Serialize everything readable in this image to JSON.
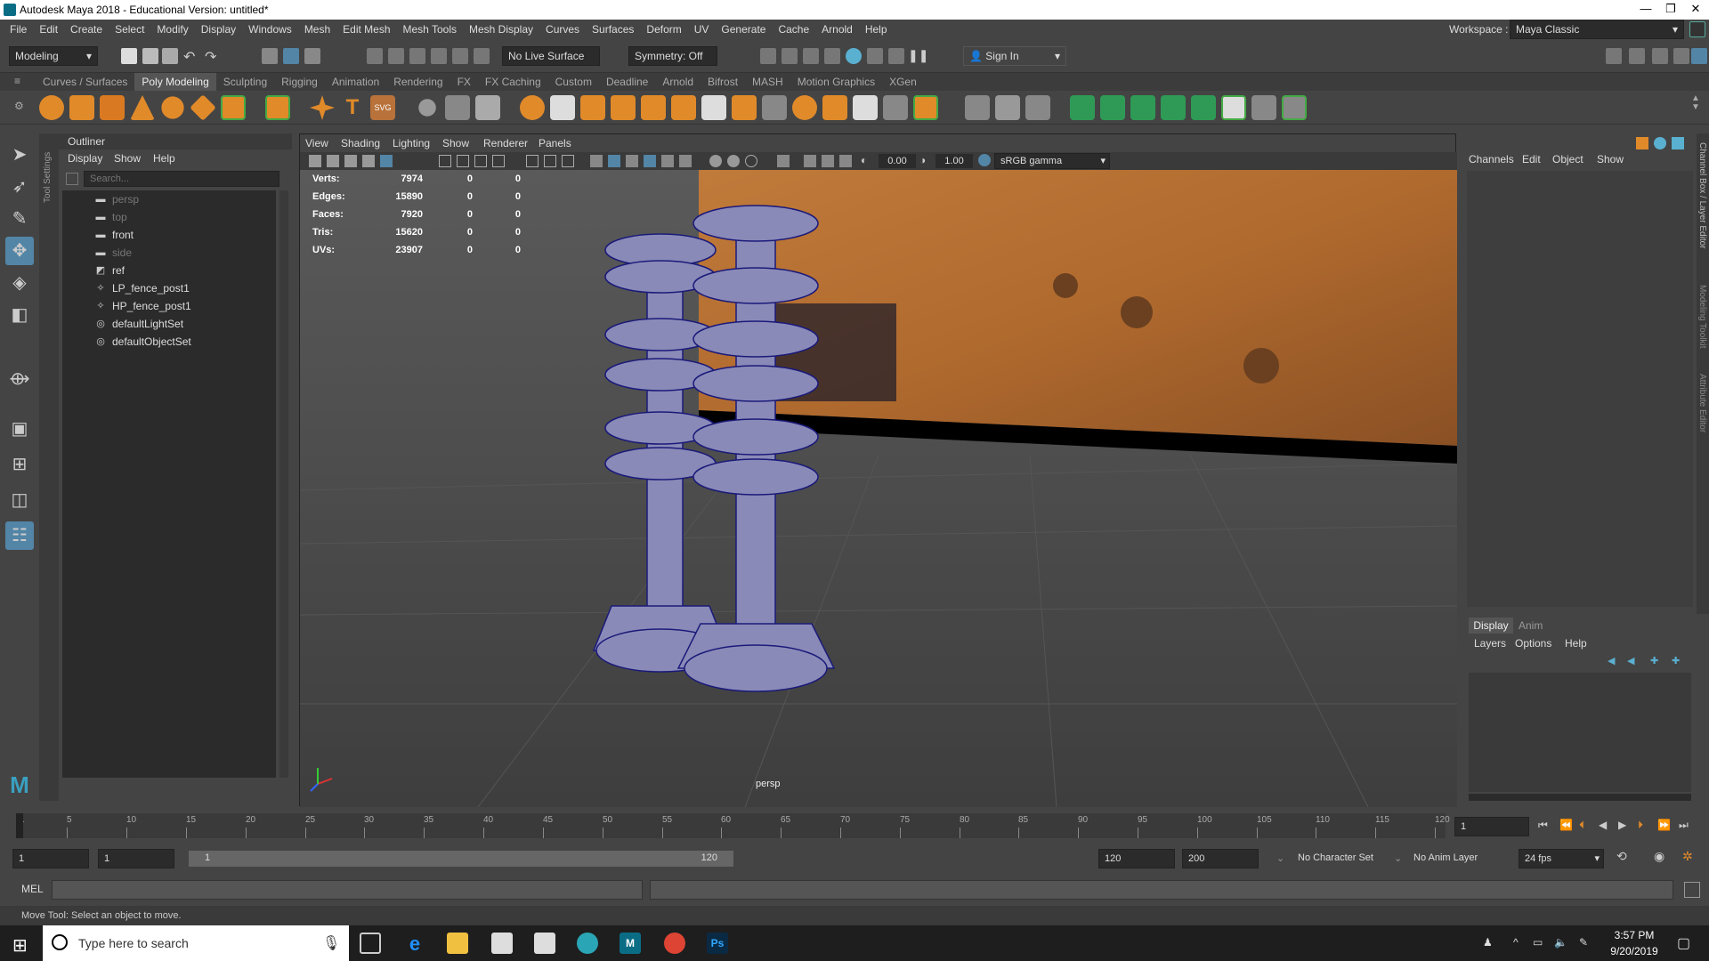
{
  "window": {
    "title": "Autodesk Maya 2018 - Educational Version: untitled*"
  },
  "menus": [
    "File",
    "Edit",
    "Create",
    "Select",
    "Modify",
    "Display",
    "Windows",
    "Mesh",
    "Edit Mesh",
    "Mesh Tools",
    "Mesh Display",
    "Curves",
    "Surfaces",
    "Deform",
    "UV",
    "Generate",
    "Cache",
    "Arnold",
    "Help"
  ],
  "workspace": {
    "label": "Workspace :",
    "value": "Maya Classic"
  },
  "statusline": {
    "menuset": "Modeling",
    "live_surface": "No Live Surface",
    "symmetry": "Symmetry: Off",
    "sign_in": "Sign In"
  },
  "shelf_tabs": [
    "Curves / Surfaces",
    "Poly Modeling",
    "Sculpting",
    "Rigging",
    "Animation",
    "Rendering",
    "FX",
    "FX Caching",
    "Custom",
    "Deadline",
    "Arnold",
    "Bifrost",
    "MASH",
    "Motion Graphics",
    "XGen"
  ],
  "shelf_active": "Poly Modeling",
  "outliner": {
    "title": "Outliner",
    "menus": [
      "Display",
      "Show",
      "Help"
    ],
    "search_placeholder": "Search...",
    "items": [
      {
        "label": "persp",
        "icon": "camera-icon",
        "dim": true
      },
      {
        "label": "top",
        "icon": "camera-icon",
        "dim": true
      },
      {
        "label": "front",
        "icon": "camera-icon",
        "dim": false
      },
      {
        "label": "side",
        "icon": "camera-icon",
        "dim": true
      },
      {
        "label": "ref",
        "icon": "image-plane-icon",
        "dim": false
      },
      {
        "label": "LP_fence_post1",
        "icon": "transform-icon",
        "dim": false
      },
      {
        "label": "HP_fence_post1",
        "icon": "transform-icon",
        "dim": false
      },
      {
        "label": "defaultLightSet",
        "icon": "set-icon",
        "dim": false
      },
      {
        "label": "defaultObjectSet",
        "icon": "set-icon",
        "dim": false
      }
    ]
  },
  "viewport": {
    "menus": [
      "View",
      "Shading",
      "Lighting",
      "Show",
      "Renderer",
      "Panels"
    ],
    "exposure": "0.00",
    "gamma": "1.00",
    "colorspace": "sRGB gamma",
    "camera_label": "persp",
    "hud": [
      {
        "label": "Verts:",
        "v1": "7974",
        "v2": "0",
        "v3": "0"
      },
      {
        "label": "Edges:",
        "v1": "15890",
        "v2": "0",
        "v3": "0"
      },
      {
        "label": "Faces:",
        "v1": "7920",
        "v2": "0",
        "v3": "0"
      },
      {
        "label": "Tris:",
        "v1": "15620",
        "v2": "0",
        "v3": "0"
      },
      {
        "label": "UVs:",
        "v1": "23907",
        "v2": "0",
        "v3": "0"
      }
    ]
  },
  "channelbox": {
    "menus": [
      "Channels",
      "Edit",
      "Object",
      "Show"
    ]
  },
  "side_tabs": [
    "Channel Box / Layer Editor",
    "Modeling Toolkit",
    "Attribute Editor"
  ],
  "tool_settings_label": "Tool Settings",
  "layer_editor": {
    "tabs": [
      "Display",
      "Anim"
    ],
    "menus": [
      "Layers",
      "Options",
      "Help"
    ]
  },
  "timeline": {
    "ticks": [
      "1",
      "5",
      "10",
      "15",
      "20",
      "25",
      "30",
      "35",
      "40",
      "45",
      "50",
      "55",
      "60",
      "65",
      "70",
      "75",
      "80",
      "85",
      "90",
      "95",
      "100",
      "105",
      "110",
      "115",
      "120"
    ],
    "current_frame": "1"
  },
  "range": {
    "start": "1",
    "anim_start": "1",
    "range_start": "1",
    "range_end": "120",
    "end": "120",
    "anim_end": "200",
    "character_set": "No Character Set",
    "anim_layer": "No Anim Layer",
    "fps": "24 fps"
  },
  "cmdline": {
    "label": "MEL"
  },
  "helpline": "Move Tool: Select an object to move.",
  "taskbar": {
    "search": "Type here to search",
    "time": "3:57 PM",
    "date": "9/20/2019"
  },
  "colors": {
    "accent": "#5285a6",
    "wire": "#1a1a7a",
    "mesh": "#7a7aaa"
  }
}
